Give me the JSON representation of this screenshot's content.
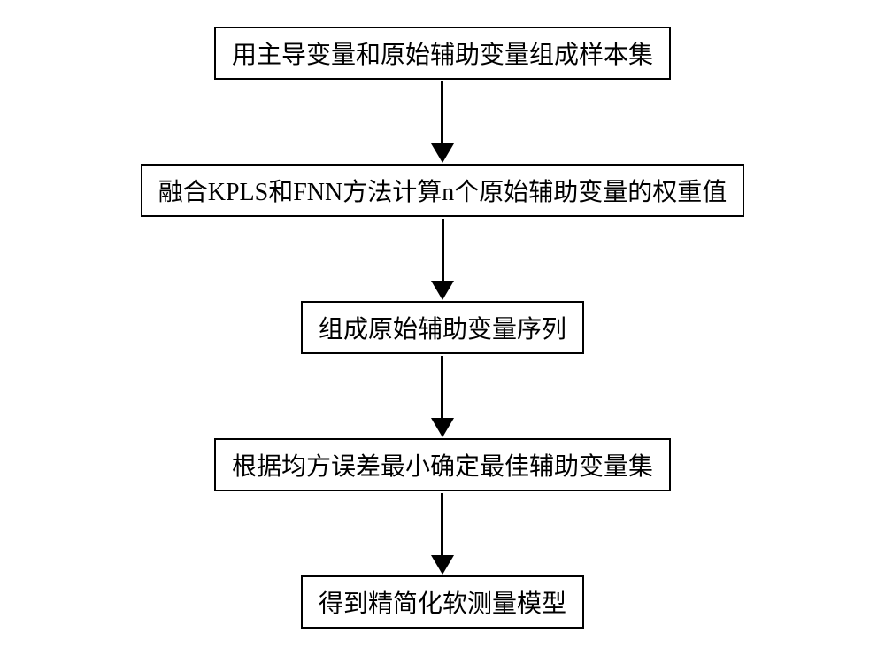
{
  "flowchart": {
    "steps": [
      {
        "label": "用主导变量和原始辅助变量组成样本集"
      },
      {
        "label": "融合KPLS和FNN方法计算n个原始辅助变量的权重值"
      },
      {
        "label": "组成原始辅助变量序列"
      },
      {
        "label": "根据均方误差最小确定最佳辅助变量集"
      },
      {
        "label": "得到精简化软测量模型"
      }
    ]
  }
}
